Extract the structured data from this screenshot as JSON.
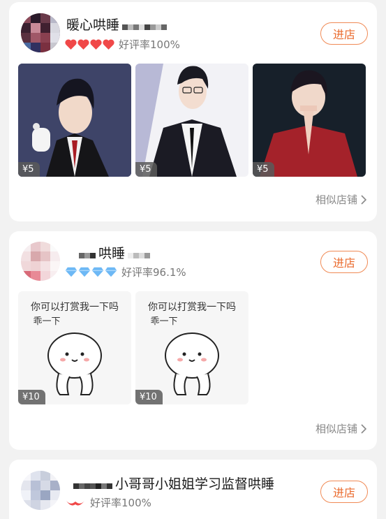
{
  "shops": [
    {
      "name": "暖心哄睡",
      "rating": "好评率100%",
      "enter_label": "进店",
      "similar_label": "相似店铺",
      "level_icon": "heart-icon",
      "level_color": "#f04848",
      "level_count": 4,
      "products": [
        {
          "price": "¥5",
          "icon": "anime-man-suit-image"
        },
        {
          "price": "¥5",
          "icon": "anime-man-tie-image"
        },
        {
          "price": "¥5",
          "icon": "anime-boy-red-hoodie-image"
        }
      ]
    },
    {
      "name": "哄睡",
      "rating": "好评率96.1%",
      "enter_label": "进店",
      "similar_label": "相似店铺",
      "level_icon": "diamond-icon",
      "level_color": "#6db8f5",
      "level_count": 4,
      "products": [
        {
          "price": "¥10",
          "meme_line1": "你可以打赏我一下吗",
          "meme_line2": "乖一下"
        },
        {
          "price": "¥10",
          "meme_line1": "你可以打赏我一下吗",
          "meme_line2": "乖一下"
        }
      ]
    },
    {
      "name": "小哥哥小姐姐学习监督哄睡",
      "rating": "好评率100%",
      "enter_label": "进店",
      "level_icon": "heart-icon",
      "level_color": "#f04848"
    }
  ]
}
